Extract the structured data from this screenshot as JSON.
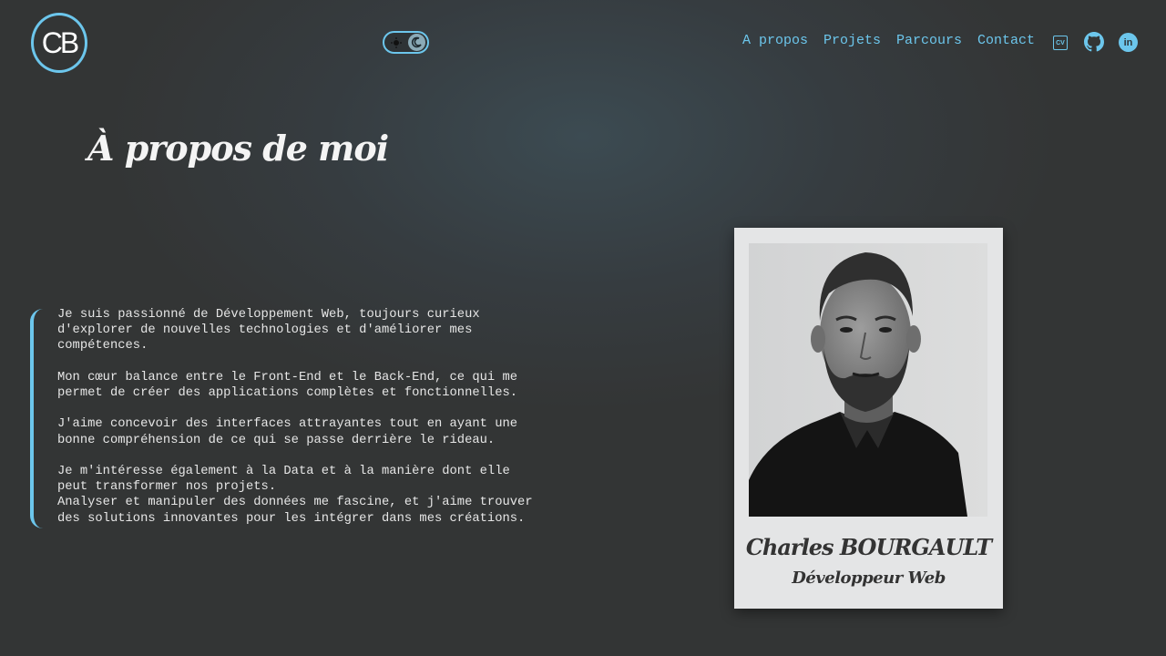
{
  "header": {
    "logo_text": "CB",
    "nav": [
      "A propos",
      "Projets",
      "Parcours",
      "Contact"
    ],
    "cv_label": "CV",
    "linkedin_label": "in"
  },
  "about": {
    "title": "À propos de moi",
    "paragraphs": [
      "Je suis passionné de Développement Web, toujours curieux\nd'explorer de nouvelles technologies et d'améliorer mes\ncompétences.",
      "Mon cœur balance entre le Front-End et le Back-End, ce qui me\npermet de créer des applications complètes et fonctionnelles.",
      "J'aime concevoir des interfaces attrayantes tout en ayant une\nbonne compréhension de ce qui se passe derrière le rideau.",
      "Je m'intéresse également à la Data et à la manière dont elle\npeut transformer nos projets.\nAnalyser et manipuler des données me fascine, et j'aime trouver\ndes solutions innovantes pour les intégrer dans mes créations."
    ]
  },
  "profile": {
    "name": "Charles BOURGAULT",
    "role": "Développeur Web"
  },
  "colors": {
    "accent": "#6cc6ec",
    "background": "#333535"
  }
}
